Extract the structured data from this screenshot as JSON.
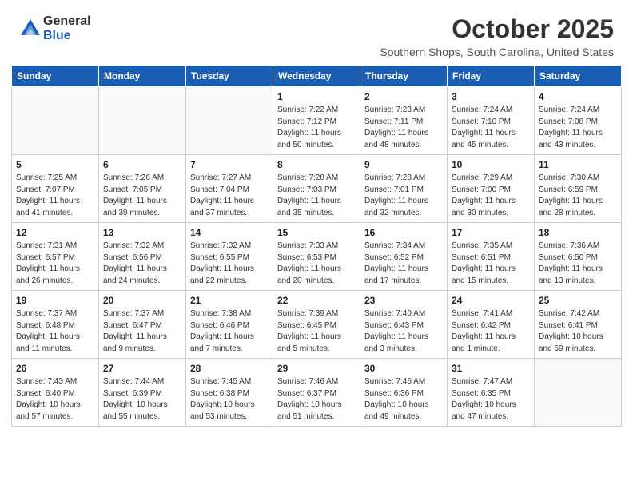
{
  "header": {
    "logo_general": "General",
    "logo_blue": "Blue",
    "month_title": "October 2025",
    "location": "Southern Shops, South Carolina, United States"
  },
  "weekdays": [
    "Sunday",
    "Monday",
    "Tuesday",
    "Wednesday",
    "Thursday",
    "Friday",
    "Saturday"
  ],
  "weeks": [
    [
      {
        "day": "",
        "info": ""
      },
      {
        "day": "",
        "info": ""
      },
      {
        "day": "",
        "info": ""
      },
      {
        "day": "1",
        "info": "Sunrise: 7:22 AM\nSunset: 7:12 PM\nDaylight: 11 hours\nand 50 minutes."
      },
      {
        "day": "2",
        "info": "Sunrise: 7:23 AM\nSunset: 7:11 PM\nDaylight: 11 hours\nand 48 minutes."
      },
      {
        "day": "3",
        "info": "Sunrise: 7:24 AM\nSunset: 7:10 PM\nDaylight: 11 hours\nand 45 minutes."
      },
      {
        "day": "4",
        "info": "Sunrise: 7:24 AM\nSunset: 7:08 PM\nDaylight: 11 hours\nand 43 minutes."
      }
    ],
    [
      {
        "day": "5",
        "info": "Sunrise: 7:25 AM\nSunset: 7:07 PM\nDaylight: 11 hours\nand 41 minutes."
      },
      {
        "day": "6",
        "info": "Sunrise: 7:26 AM\nSunset: 7:05 PM\nDaylight: 11 hours\nand 39 minutes."
      },
      {
        "day": "7",
        "info": "Sunrise: 7:27 AM\nSunset: 7:04 PM\nDaylight: 11 hours\nand 37 minutes."
      },
      {
        "day": "8",
        "info": "Sunrise: 7:28 AM\nSunset: 7:03 PM\nDaylight: 11 hours\nand 35 minutes."
      },
      {
        "day": "9",
        "info": "Sunrise: 7:28 AM\nSunset: 7:01 PM\nDaylight: 11 hours\nand 32 minutes."
      },
      {
        "day": "10",
        "info": "Sunrise: 7:29 AM\nSunset: 7:00 PM\nDaylight: 11 hours\nand 30 minutes."
      },
      {
        "day": "11",
        "info": "Sunrise: 7:30 AM\nSunset: 6:59 PM\nDaylight: 11 hours\nand 28 minutes."
      }
    ],
    [
      {
        "day": "12",
        "info": "Sunrise: 7:31 AM\nSunset: 6:57 PM\nDaylight: 11 hours\nand 26 minutes."
      },
      {
        "day": "13",
        "info": "Sunrise: 7:32 AM\nSunset: 6:56 PM\nDaylight: 11 hours\nand 24 minutes."
      },
      {
        "day": "14",
        "info": "Sunrise: 7:32 AM\nSunset: 6:55 PM\nDaylight: 11 hours\nand 22 minutes."
      },
      {
        "day": "15",
        "info": "Sunrise: 7:33 AM\nSunset: 6:53 PM\nDaylight: 11 hours\nand 20 minutes."
      },
      {
        "day": "16",
        "info": "Sunrise: 7:34 AM\nSunset: 6:52 PM\nDaylight: 11 hours\nand 17 minutes."
      },
      {
        "day": "17",
        "info": "Sunrise: 7:35 AM\nSunset: 6:51 PM\nDaylight: 11 hours\nand 15 minutes."
      },
      {
        "day": "18",
        "info": "Sunrise: 7:36 AM\nSunset: 6:50 PM\nDaylight: 11 hours\nand 13 minutes."
      }
    ],
    [
      {
        "day": "19",
        "info": "Sunrise: 7:37 AM\nSunset: 6:48 PM\nDaylight: 11 hours\nand 11 minutes."
      },
      {
        "day": "20",
        "info": "Sunrise: 7:37 AM\nSunset: 6:47 PM\nDaylight: 11 hours\nand 9 minutes."
      },
      {
        "day": "21",
        "info": "Sunrise: 7:38 AM\nSunset: 6:46 PM\nDaylight: 11 hours\nand 7 minutes."
      },
      {
        "day": "22",
        "info": "Sunrise: 7:39 AM\nSunset: 6:45 PM\nDaylight: 11 hours\nand 5 minutes."
      },
      {
        "day": "23",
        "info": "Sunrise: 7:40 AM\nSunset: 6:43 PM\nDaylight: 11 hours\nand 3 minutes."
      },
      {
        "day": "24",
        "info": "Sunrise: 7:41 AM\nSunset: 6:42 PM\nDaylight: 11 hours\nand 1 minute."
      },
      {
        "day": "25",
        "info": "Sunrise: 7:42 AM\nSunset: 6:41 PM\nDaylight: 10 hours\nand 59 minutes."
      }
    ],
    [
      {
        "day": "26",
        "info": "Sunrise: 7:43 AM\nSunset: 6:40 PM\nDaylight: 10 hours\nand 57 minutes."
      },
      {
        "day": "27",
        "info": "Sunrise: 7:44 AM\nSunset: 6:39 PM\nDaylight: 10 hours\nand 55 minutes."
      },
      {
        "day": "28",
        "info": "Sunrise: 7:45 AM\nSunset: 6:38 PM\nDaylight: 10 hours\nand 53 minutes."
      },
      {
        "day": "29",
        "info": "Sunrise: 7:46 AM\nSunset: 6:37 PM\nDaylight: 10 hours\nand 51 minutes."
      },
      {
        "day": "30",
        "info": "Sunrise: 7:46 AM\nSunset: 6:36 PM\nDaylight: 10 hours\nand 49 minutes."
      },
      {
        "day": "31",
        "info": "Sunrise: 7:47 AM\nSunset: 6:35 PM\nDaylight: 10 hours\nand 47 minutes."
      },
      {
        "day": "",
        "info": ""
      }
    ]
  ]
}
